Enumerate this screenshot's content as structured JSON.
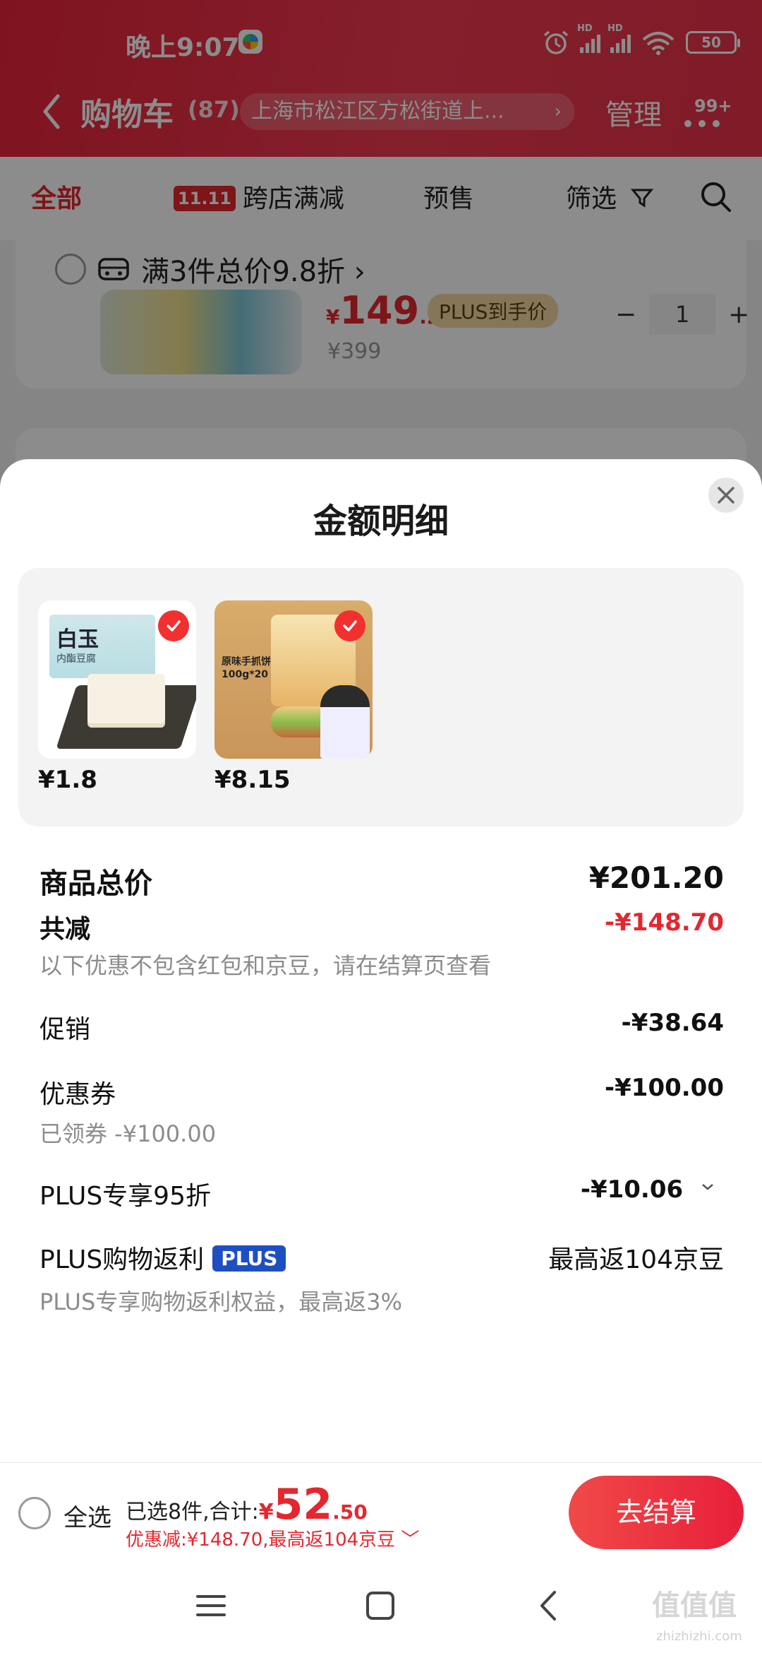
{
  "status_bar": {
    "time": "晚上9:07",
    "signal1_label": "HD",
    "signal2_label": "HD",
    "battery": "50"
  },
  "navbar": {
    "title": "购物车",
    "count": "(87)",
    "address": "上海市松江区方松街道上...",
    "manage": "管理",
    "more_badge": "99+"
  },
  "tabs": {
    "all": "全部",
    "badge_11": "11.11",
    "cross_store": "跨店满减",
    "presale": "预售",
    "filter": "筛选"
  },
  "cart_preview": {
    "promo": "满3件总价9.8折 ›",
    "price_yen": "¥",
    "price_int": "149",
    "price_dec": ".2",
    "plus_tag": "PLUS到手价",
    "orig_price": "¥399",
    "qty": "1",
    "minus": "−",
    "plus": "+"
  },
  "sheet": {
    "title": "金额明细",
    "items": [
      {
        "price": "¥1.8",
        "img_title": "白玉",
        "img_sub": "内酯豆腐"
      },
      {
        "price": "¥8.15",
        "img_title": "原味手抓饼\n100g*20"
      }
    ],
    "total_label": "商品总价",
    "total_value": "¥201.20",
    "discount_label": "共减",
    "discount_value": "-¥148.70",
    "discount_note": "以下优惠不包含红包和京豆，请在结算页查看",
    "promo_label": "促销",
    "promo_value": "-¥38.64",
    "coupon_label": "优惠券",
    "coupon_value": "-¥100.00",
    "coupon_note": "已领券 -¥100.00",
    "plus95_label": "PLUS专享95折",
    "plus95_value": "-¥10.06",
    "rebate_label": "PLUS购物返利",
    "rebate_badge": "PLUS",
    "rebate_value": "最高返104京豆",
    "rebate_note": "PLUS专享购物返利权益，最高返3%"
  },
  "bottom_bar": {
    "select_all": "全选",
    "selected_text": "已选8件,合计:",
    "amount_yen": "¥",
    "amount_int": "52",
    "amount_dec": ".50",
    "discount_text": "优惠减:¥148.70,最高返104京豆 ﹀",
    "checkout": "去结算"
  },
  "watermark": {
    "main": "值值值",
    "sub": "zhizhizhi.com"
  },
  "colors": {
    "brand_red": "#e4272f",
    "plus_blue": "#1e4fc2",
    "plus_gold": "#f4d8a3"
  }
}
